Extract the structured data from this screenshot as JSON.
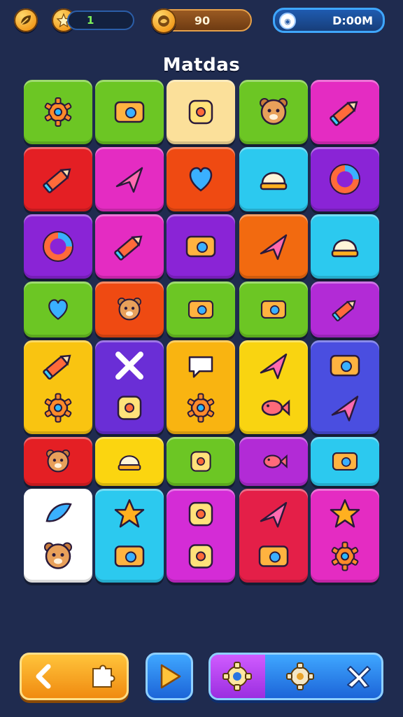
{
  "hud": {
    "lives_value": "1",
    "coins_value": "90",
    "timer_value": "D:00M"
  },
  "title": "Matdas",
  "grid": {
    "rows": 7,
    "cols": 5,
    "tiles": [
      {
        "color": "#6cc624",
        "icons": [
          "gear-icon"
        ]
      },
      {
        "color": "#6cc624",
        "icons": [
          "battery-icon"
        ]
      },
      {
        "color": "#fbe09a",
        "icons": [
          "swirl-badge-icon"
        ]
      },
      {
        "color": "#6cc624",
        "icons": [
          "monster-icon"
        ]
      },
      {
        "color": "#e42cc2",
        "icons": [
          "pencil-icon"
        ]
      },
      {
        "color": "#e41f24",
        "icons": [
          "pencil-icon"
        ]
      },
      {
        "color": "#e42cc2",
        "icons": [
          "rocket-icon"
        ]
      },
      {
        "color": "#ef4a12",
        "icons": [
          "heart-arrow-icon"
        ]
      },
      {
        "color": "#2cc9ef",
        "icons": [
          "cupcake-icon"
        ]
      },
      {
        "color": "#8a24d6",
        "icons": [
          "ring-icon"
        ]
      },
      {
        "color": "#8a24d6",
        "icons": [
          "donut-icon"
        ]
      },
      {
        "color": "#e42cc2",
        "icons": [
          "marker-icon"
        ]
      },
      {
        "color": "#8a24d6",
        "icons": [
          "camera-icon"
        ]
      },
      {
        "color": "#f26a10",
        "icons": [
          "paper-plane-icon"
        ]
      },
      {
        "color": "#2cc9ef",
        "icons": [
          "bell-icon"
        ]
      },
      {
        "color": "#6cc624",
        "icons": [
          "heart-hands-icon"
        ]
      },
      {
        "color": "#ef4a12",
        "icons": [
          "shiba-dog-icon"
        ]
      },
      {
        "color": "#6cc624",
        "icons": [
          "calculator-icon"
        ]
      },
      {
        "color": "#6cc624",
        "icons": [
          "gamepad-icon"
        ]
      },
      {
        "color": "#b22bd6",
        "icons": [
          "pencil-icon"
        ]
      },
      {
        "color": "#f9c411",
        "icons": [
          "crayon-icon",
          "sun-gear-icon"
        ]
      },
      {
        "color": "#6a2ed6",
        "icons": [
          "x-cross-icon",
          "puzzle-icon"
        ]
      },
      {
        "color": "#f9b411",
        "icons": [
          "chat-bubble-icon",
          "virus-icon"
        ]
      },
      {
        "color": "#f9d411",
        "icons": [
          "send-bubble-icon",
          "bird-icon"
        ]
      },
      {
        "color": "#4a4ee0",
        "icons": [
          "keypad-icon",
          "rocket-icon"
        ]
      },
      {
        "color": "#e41f24",
        "icons": [
          "bear-icon"
        ]
      },
      {
        "color": "#fbd510",
        "icons": [
          "helmet-icon"
        ]
      },
      {
        "color": "#6cc624",
        "icons": [
          "dropper-icon"
        ]
      },
      {
        "color": "#b22bd6",
        "icons": [
          "fish-icon"
        ]
      },
      {
        "color": "#2cc9ef",
        "icons": [
          "camera-icon"
        ]
      },
      {
        "color": "#ffffff",
        "icons": [
          "feather-icon",
          "teddy-bear-icon"
        ]
      },
      {
        "color": "#2cc9ef",
        "icons": [
          "star-icon",
          "frame-icon"
        ]
      },
      {
        "color": "#d42cd6",
        "icons": [
          "brush-icon",
          "potion-icon"
        ]
      },
      {
        "color": "#e41f48",
        "icons": [
          "arrow-badge-icon",
          "basket-icon"
        ]
      },
      {
        "color": "#e42cc2",
        "icons": [
          "star-icon",
          "sun-face-icon"
        ]
      }
    ]
  },
  "controls": {
    "back_icon": "chevron-left-icon",
    "play_icon": "play-icon",
    "tray_icons": [
      "gear-icon",
      "gear-icon",
      "x-cross-icon"
    ]
  }
}
